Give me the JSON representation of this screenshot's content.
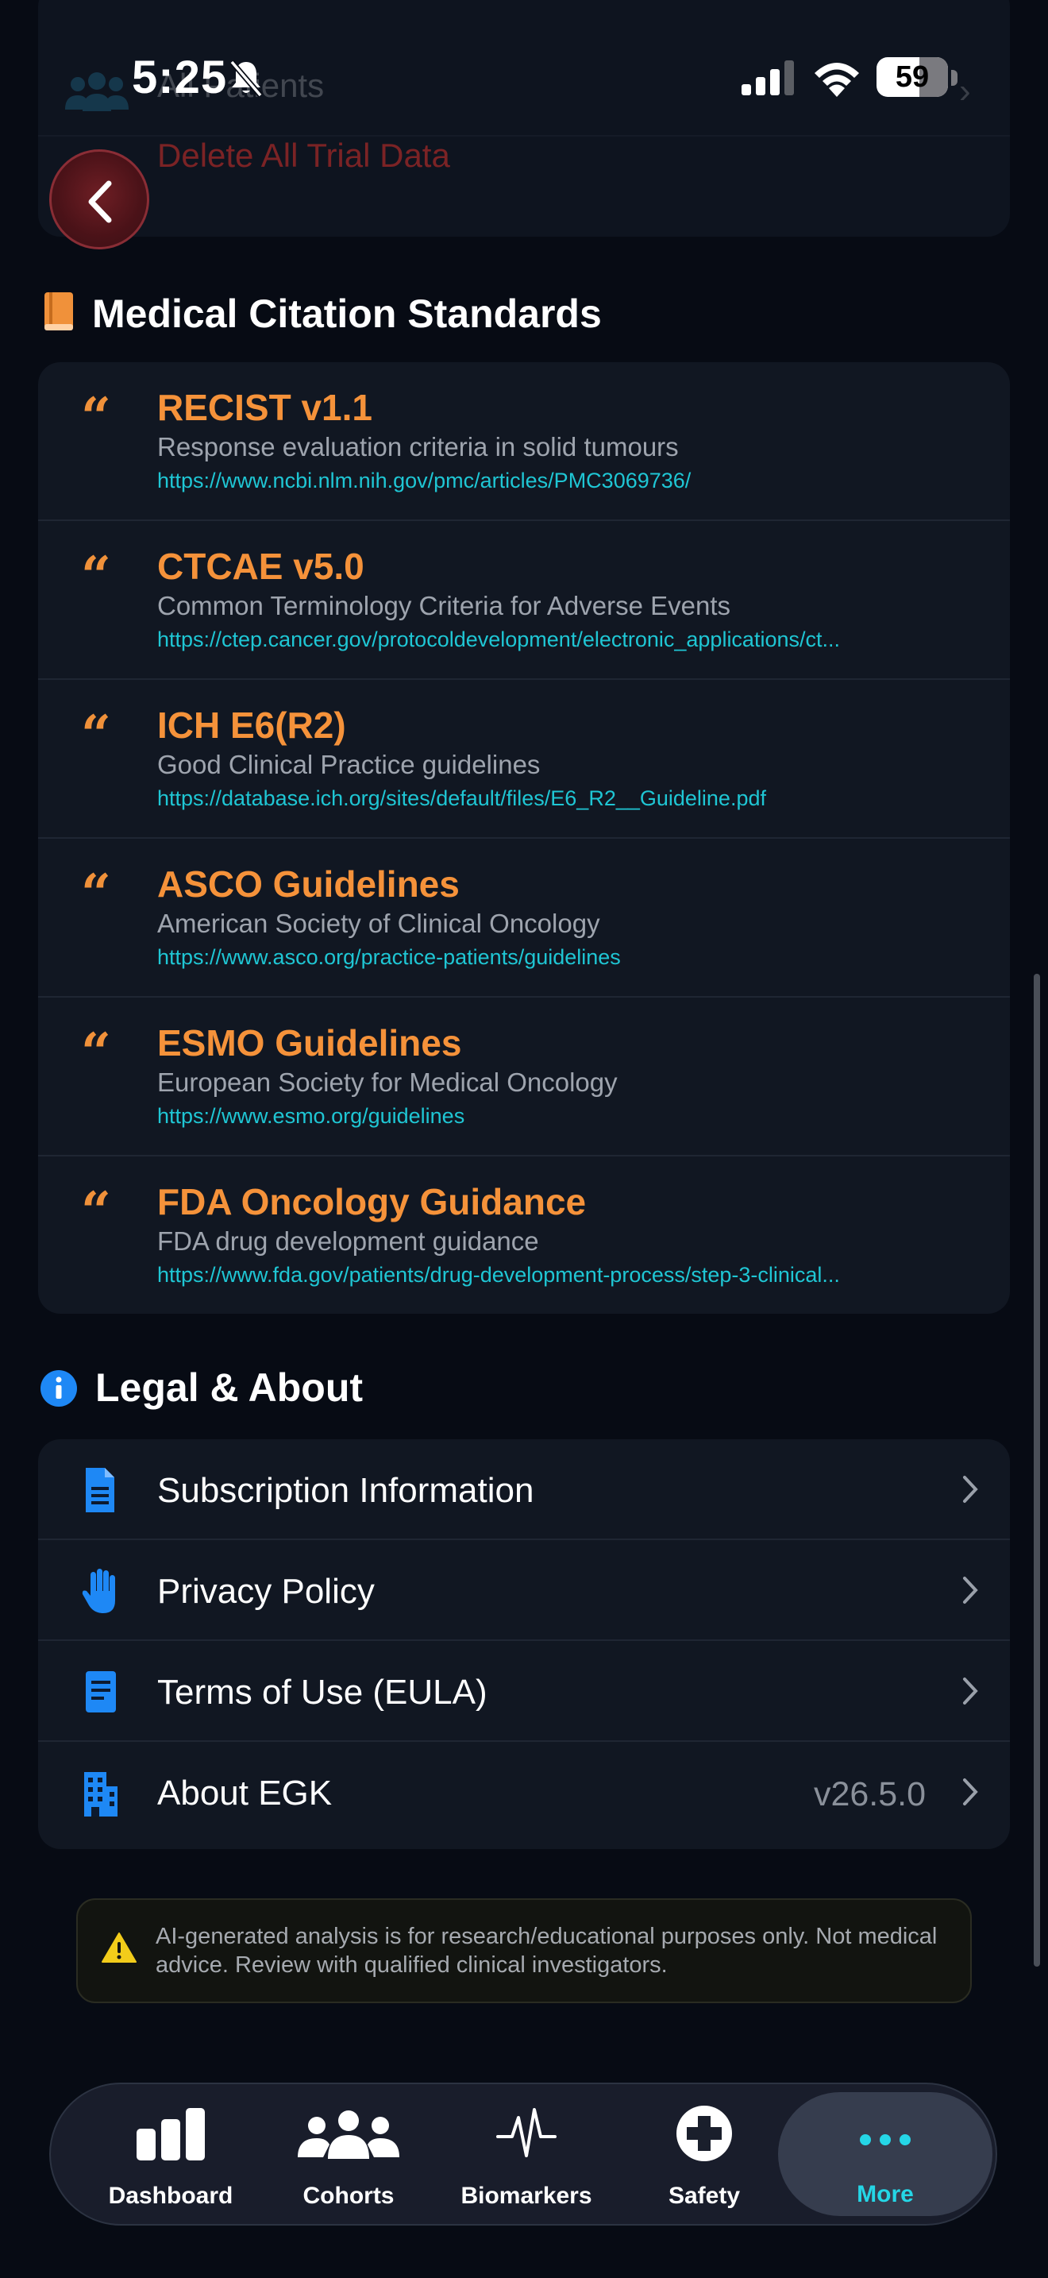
{
  "status_bar": {
    "time": "5:25",
    "battery": "59"
  },
  "top_card": {
    "faded_label": "All Patients",
    "delete_label": "Delete All Trial Data"
  },
  "citations_section": {
    "title": "Medical Citation Standards",
    "items": [
      {
        "title": "RECIST v1.1",
        "subtitle": "Response evaluation criteria in solid tumours",
        "url": "https://www.ncbi.nlm.nih.gov/pmc/articles/PMC3069736/"
      },
      {
        "title": "CTCAE v5.0",
        "subtitle": "Common Terminology Criteria for Adverse Events",
        "url": "https://ctep.cancer.gov/protocoldevelopment/electronic_applications/ct..."
      },
      {
        "title": "ICH E6(R2)",
        "subtitle": "Good Clinical Practice guidelines",
        "url": "https://database.ich.org/sites/default/files/E6_R2__Guideline.pdf"
      },
      {
        "title": "ASCO Guidelines",
        "subtitle": "American Society of Clinical Oncology",
        "url": "https://www.asco.org/practice-patients/guidelines"
      },
      {
        "title": "ESMO Guidelines",
        "subtitle": "European Society for Medical Oncology",
        "url": "https://www.esmo.org/guidelines"
      },
      {
        "title": "FDA Oncology Guidance",
        "subtitle": "FDA drug development guidance",
        "url": "https://www.fda.gov/patients/drug-development-process/step-3-clinical..."
      }
    ]
  },
  "legal_section": {
    "title": "Legal & About",
    "items": [
      {
        "label": "Subscription Information",
        "icon": "document-icon"
      },
      {
        "label": "Privacy Policy",
        "icon": "hand-icon"
      },
      {
        "label": "Terms of Use (EULA)",
        "icon": "note-icon"
      },
      {
        "label": "About EGK",
        "icon": "building-icon",
        "value": "v26.5.0"
      }
    ]
  },
  "disclaimer": "AI-generated analysis is for research/educational purposes only. Not medical advice. Review with qualified clinical investigators.",
  "tab_bar": {
    "tabs": [
      {
        "label": "Dashboard",
        "icon": "chart-bars-icon"
      },
      {
        "label": "Cohorts",
        "icon": "people-icon"
      },
      {
        "label": "Biomarkers",
        "icon": "pulse-icon"
      },
      {
        "label": "Safety",
        "icon": "medical-cross-icon"
      },
      {
        "label": "More",
        "icon": "ellipsis-icon",
        "active": true
      }
    ]
  },
  "colors": {
    "accent_orange": "#f5923a",
    "link_cyan": "#1fc6d4",
    "active_tab": "#25d6e6",
    "icon_blue": "#1e88f5"
  }
}
